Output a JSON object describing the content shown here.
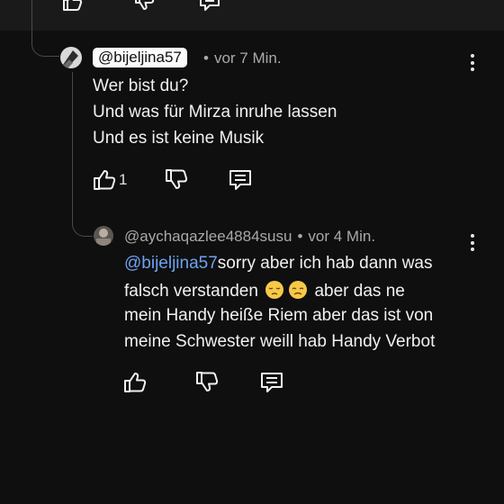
{
  "comment": {
    "handle": "@bijeljina57",
    "time": "vor 7 Min.",
    "lines": [
      "Wer bist du?",
      "Und was für Mirza inruhe lassen",
      "Und es ist keine Musik"
    ],
    "like_count": "1"
  },
  "reply": {
    "handle": "@aychaqazlee4884susu",
    "time": "vor 4 Min.",
    "mention": "@bijeljina57",
    "line1_rest": "sorry aber ich hab dann was",
    "line2_a": "falsch verstanden",
    "line2_b": "aber  das ne",
    "line3": "mein Handy heiße Riem aber das ist von",
    "line4": "meine Schwester weill hab Handy Verbot",
    "emojis": [
      "pensive-face",
      "disappointed-face"
    ]
  },
  "separator": "•",
  "icons": [
    "thumbs-up-icon",
    "thumbs-down-icon",
    "reply-icon",
    "more-vertical-icon"
  ]
}
